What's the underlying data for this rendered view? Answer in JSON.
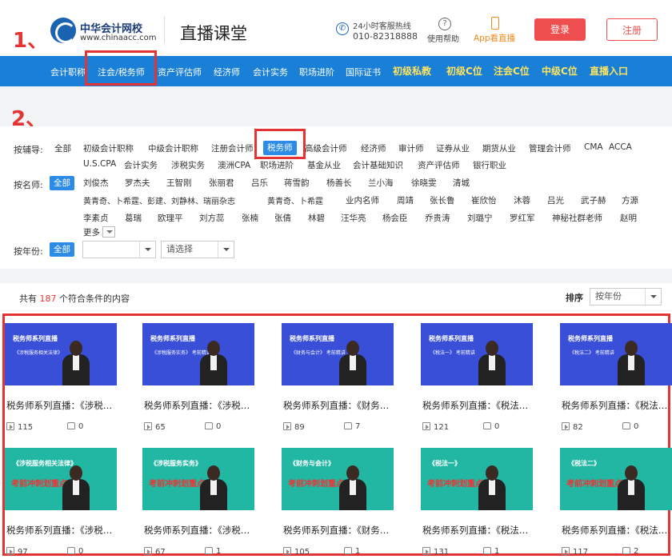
{
  "header": {
    "logo_title": "中华会计网校",
    "logo_url": "www.chinaacc.com",
    "page_title": "直播课堂",
    "hotline_label": "24小时客服热线",
    "hotline_number": "010-82318888",
    "help_label": "使用帮助",
    "app_label": "App看直播",
    "login": "登录",
    "register": "注册"
  },
  "nav": {
    "items": [
      "会计职称",
      "注会/税务师",
      "资产评估师",
      "经济师",
      "会计实务",
      "职场进阶",
      "国际证书"
    ],
    "bold_items": [
      "初级私教",
      "初级C位",
      "注会C位",
      "中级C位",
      "直播入口"
    ]
  },
  "annotations": {
    "one": "1、",
    "two": "2、"
  },
  "filters": {
    "cat_label": "按辅导:",
    "cat_row1": [
      "全部",
      "初级会计职称",
      "中级会计职称",
      "注册会计师",
      "税务师",
      "高级会计师",
      "经济师",
      "审计师",
      "证券从业",
      "期货从业",
      "管理会计师",
      "CMA",
      "ACCA"
    ],
    "cat_row2": [
      "U.S.CPA",
      "会计实务",
      "涉税实务",
      "澳洲CPA",
      "职场进阶",
      "基金从业",
      "会计基础知识",
      "资产评估师",
      "银行职业"
    ],
    "teacher_label": "按名师:",
    "teacher_all": "全部",
    "teacher_row1": [
      "刘俊杰",
      "罗杰夫",
      "王智刚",
      "张丽君",
      "吕乐",
      "蒋雪韵",
      "杨善长",
      "兰小海",
      "徐晓雯",
      "清城"
    ],
    "teacher_row2": [
      "黄青奇、卜希霆、彭建、刘静林、瑞丽杂志",
      "黄青奇、卜希霆",
      "业内名师",
      "周靖",
      "张长鲁",
      "崔欣怡",
      "沐蓉",
      "吕光",
      "武子赫",
      "方源"
    ],
    "teacher_row3": [
      "李素贞",
      "葛瑞",
      "欧理平",
      "刘方蕊",
      "张楠",
      "张倩",
      "林碧",
      "汪华亮",
      "杨会臣",
      "乔贵涛",
      "刘璐宁",
      "罗红军",
      "神秘社群老师",
      "赵明"
    ],
    "more": "更多",
    "year_label": "按年份:",
    "year_all": "全部",
    "select_placeholder": "请选择"
  },
  "results": {
    "prefix": "共有",
    "count": "187",
    "suffix": "个符合条件的内容",
    "sort_label": "排序",
    "sort_value": "按年份"
  },
  "cards": [
    {
      "title": "税务师系列直播：《涉税…",
      "views": "115",
      "likes": "0",
      "thumb_label": "税务师系列直播",
      "thumb_sub": "《涉税服务相关法律》"
    },
    {
      "title": "税务师系列直播：《涉税…",
      "views": "65",
      "likes": "0",
      "thumb_label": "税务师系列直播",
      "thumb_sub": "《涉税服务实务》 考前精讲"
    },
    {
      "title": "税务师系列直播：《财务…",
      "views": "89",
      "likes": "7",
      "thumb_label": "税务师系列直播",
      "thumb_sub": "《财务与会计》 考前精讲"
    },
    {
      "title": "税务师系列直播：《税法…",
      "views": "121",
      "likes": "0",
      "thumb_label": "税务师系列直播",
      "thumb_sub": "《税法一》 考前精讲"
    },
    {
      "title": "税务师系列直播：《税法…",
      "views": "82",
      "likes": "0",
      "thumb_label": "税务师系列直播",
      "thumb_sub": "《税法二》 考前精讲"
    },
    {
      "title": "税务师系列直播：《涉税…",
      "views": "97",
      "likes": "0",
      "thumb_label": "《涉税服务相关法律》",
      "thumb_sub": "考前冲刺划重点"
    },
    {
      "title": "税务师系列直播：《涉税…",
      "views": "67",
      "likes": "1",
      "thumb_label": "《涉税服务实务》",
      "thumb_sub": "考前冲刺划重点"
    },
    {
      "title": "税务师系列直播：《财务…",
      "views": "105",
      "likes": "1",
      "thumb_label": "《财务与会计》",
      "thumb_sub": "考前冲刺划重点"
    },
    {
      "title": "税务师系列直播：《税法…",
      "views": "131",
      "likes": "1",
      "thumb_label": "《税法一》",
      "thumb_sub": "考前冲刺划重点"
    },
    {
      "title": "税务师系列直播：《税法…",
      "views": "117",
      "likes": "2",
      "thumb_label": "《税法二》",
      "thumb_sub": "考前冲刺划重点"
    }
  ]
}
